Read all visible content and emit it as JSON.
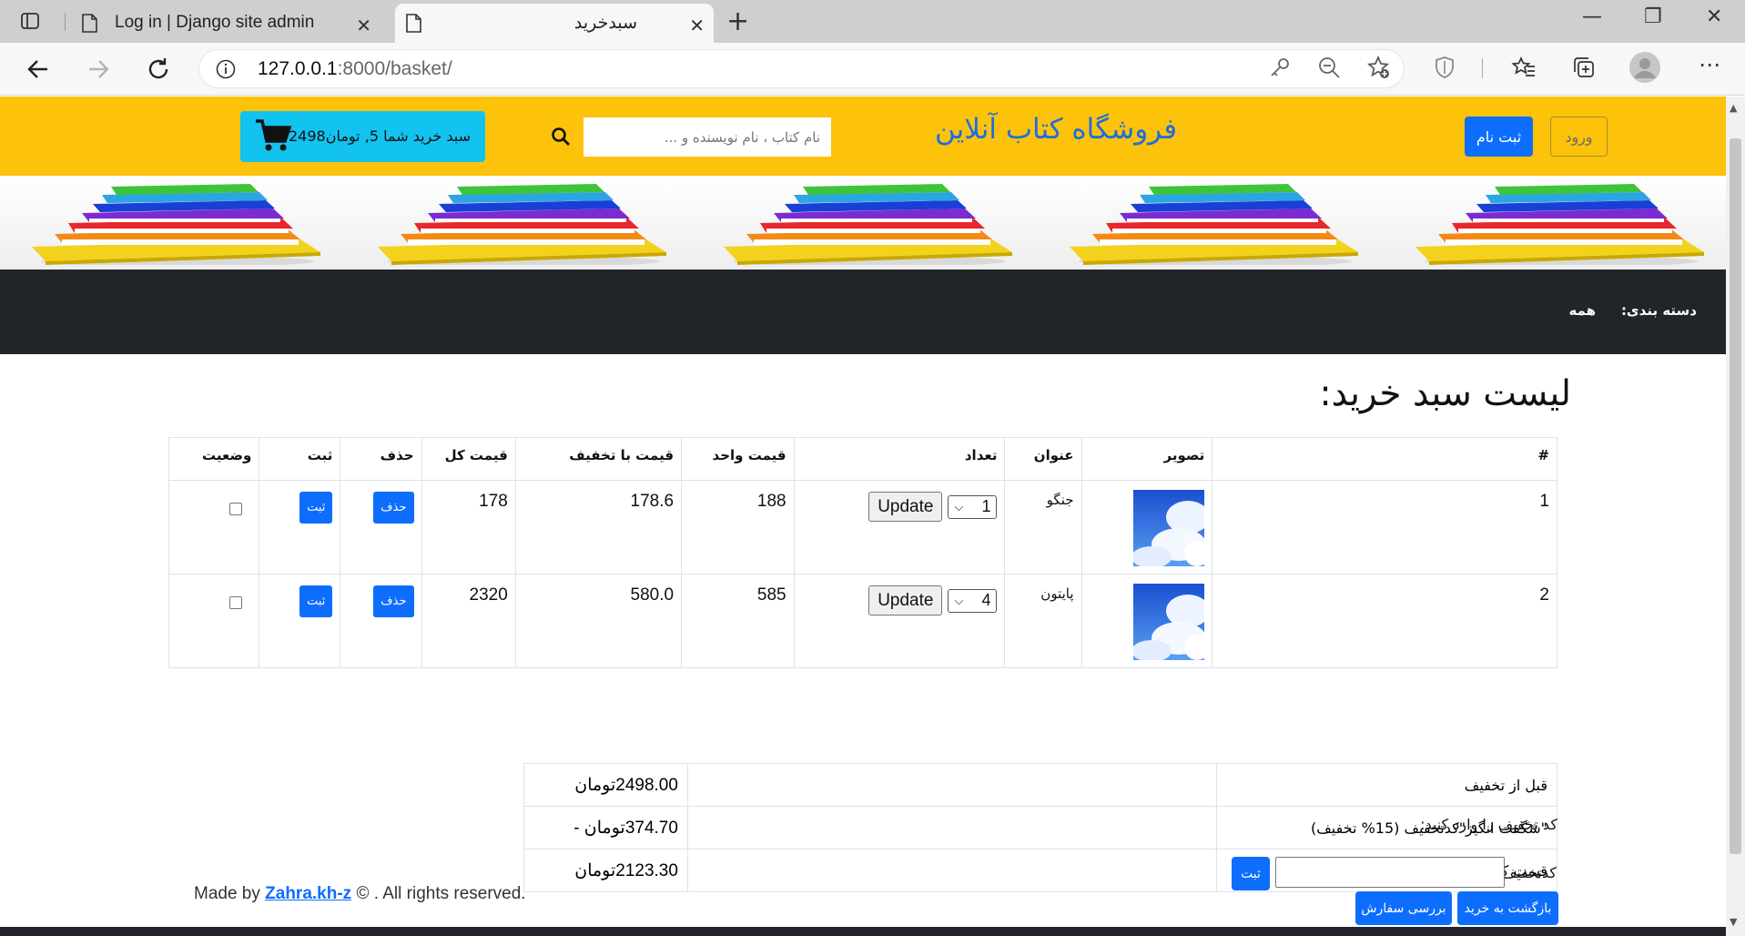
{
  "browser": {
    "tabs": [
      {
        "title": "Log in | Django site admin"
      },
      {
        "title": "سبدخرید"
      }
    ],
    "url_host": "127.0.0.1",
    "url_path": ":8000/basket/"
  },
  "header": {
    "login_label": "ورود",
    "signup_label": "ثبت نام",
    "site_title": "فروشگاه کتاب آنلاین",
    "search_placeholder": "نام کتاب ، نام نویسنده و ...",
    "cart_label": "سبد خرید شما 5, تومان2498"
  },
  "category_bar": {
    "label": "دسته بندی:",
    "all": "همه"
  },
  "basket": {
    "heading": "لیست سبد خرید:",
    "columns": [
      "#",
      "تصویر",
      "عنوان",
      "تعداد",
      "قیمت واحد",
      "قیمت با تخفیف",
      "قیمت کل",
      "حذف",
      "ثبت",
      "وضعیت"
    ],
    "rows": [
      {
        "index": "1",
        "title": "جنگو",
        "qty": "1",
        "update_label": "Update",
        "unit_price": "188",
        "discounted_price": "178.6",
        "total_price": "178",
        "delete_label": "حذف",
        "submit_label": "ثبت"
      },
      {
        "index": "2",
        "title": "پایتون",
        "qty": "4",
        "update_label": "Update",
        "unit_price": "585",
        "discounted_price": "580.0",
        "total_price": "2320",
        "delete_label": "حذف",
        "submit_label": "ثبت"
      }
    ]
  },
  "totals": [
    {
      "label": "قبل از تخفیف",
      "value": "2498.00تومان"
    },
    {
      "label": "\"شگفت انگیز\"کدتخفیف (15% تخفیف)",
      "value": "374.70تومان -"
    },
    {
      "label": "قیمت کلی",
      "value": "2123.30تومان"
    }
  ],
  "discount": {
    "prompt": "کد تخفیف را وارد کنید:",
    "field_label": "کدتخفیف:",
    "submit_label": "ثبت"
  },
  "actions": {
    "back_label": "بازگشت به خرید",
    "review_label": "بررسی سفارش"
  },
  "footer": {
    "prefix": "Made by",
    "author": "Zahra.kh-z",
    "suffix": "© . All rights reserved."
  },
  "colors": {
    "header_bg": "#fcc30a",
    "primary": "#0d6efd",
    "cart_bg": "#12c2ef",
    "dark_bar": "#212529"
  }
}
